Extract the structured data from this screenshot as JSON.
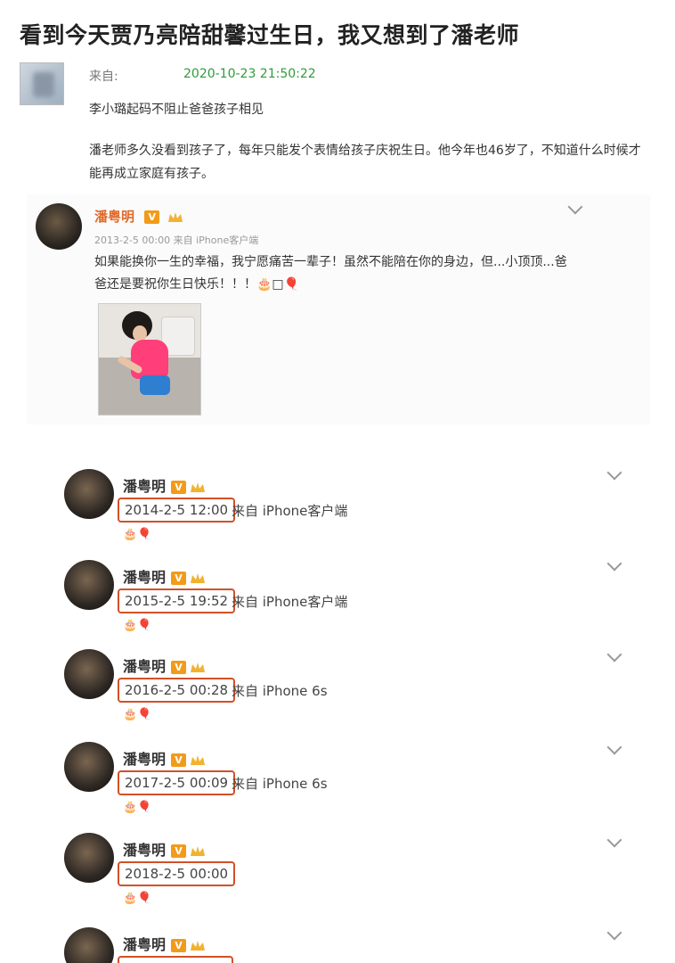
{
  "title": "看到今天贾乃亮陪甜馨过生日，我又想到了潘老师",
  "post": {
    "from_label": "来自:",
    "time": "2020-10-23 21:50:22",
    "line1": "李小璐起码不阻止爸爸孩子相见",
    "paragraph": "潘老师多久没看到孩子了，每年只能发个表情给孩子庆祝生日。他今年也46岁了，不知道什么时候才能再成立家庭有孩子。"
  },
  "card": {
    "name": "潘粤明",
    "badge": "V",
    "meta": "2013-2-5 00:00 来自 iPhone客户端",
    "text": "如果能换你一生的幸福，我宁愿痛苦一辈子！虽然不能陪在你的身边，但...小顶顶...爸爸还是要祝你生日快乐！！！🎂□🎈"
  },
  "entries": [
    {
      "name": "潘粤明",
      "badge": "V",
      "date": "2014-2-5 12:00",
      "source": "来自 iPhone客户端",
      "emoji": "🎂🎈"
    },
    {
      "name": "潘粤明",
      "badge": "V",
      "date": "2015-2-5 19:52",
      "source": "来自 iPhone客户端",
      "emoji": "🎂🎈"
    },
    {
      "name": "潘粤明",
      "badge": "V",
      "date": "2016-2-5 00:28",
      "source": "来自 iPhone 6s",
      "emoji": "🎂🎈"
    },
    {
      "name": "潘粤明",
      "badge": "V",
      "date": "2017-2-5 00:09",
      "source": "来自 iPhone 6s",
      "emoji": "🎂🎈"
    },
    {
      "name": "潘粤明",
      "badge": "V",
      "date": "2018-2-5 00:00",
      "source": "",
      "emoji": "🎂🎈"
    },
    {
      "name": "潘粤明",
      "badge": "V",
      "date": "",
      "source": "",
      "emoji": ""
    }
  ],
  "colors": {
    "timestamp_green": "#2e9b3a",
    "highlight_red": "#d25028",
    "name_orange": "#e06a2a",
    "v_badge": "#f29b1a"
  }
}
